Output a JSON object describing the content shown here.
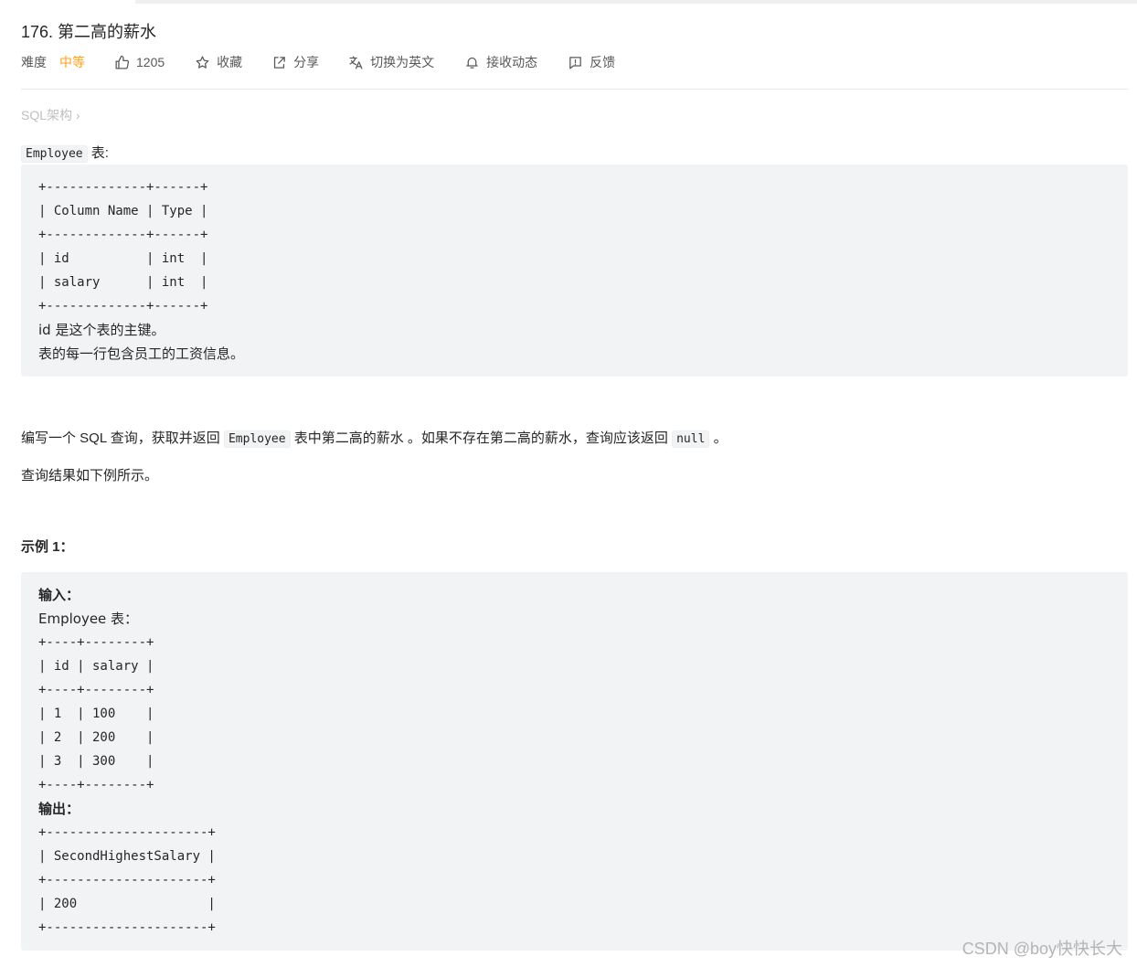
{
  "problem": {
    "title": "176. 第二高的薪水",
    "difficulty_label": "难度",
    "difficulty_value": "中等",
    "likes": "1205",
    "favorite_label": "收藏",
    "share_label": "分享",
    "translate_label": "切换为英文",
    "notify_label": "接收动态",
    "feedback_label": "反馈",
    "schema_link": "SQL架构",
    "schema_chevron": "›"
  },
  "colors": {
    "difficulty_medium": "#ffa116",
    "code_background": "#f2f3f5"
  },
  "icons": {
    "like": "thumbs-up-icon",
    "favorite": "star-icon",
    "share": "share-icon",
    "translate": "translate-icon",
    "notify": "bell-icon",
    "feedback": "feedback-icon"
  },
  "description": {
    "table_code": "Employee",
    "table_suffix": " 表:",
    "schema_block": [
      "+-------------+------+",
      "| Column Name | Type |",
      "+-------------+------+",
      "| id          | int  |",
      "| salary      | int  |",
      "+-------------+------+",
      "id 是这个表的主键。",
      "表的每一行包含员工的工资信息。"
    ],
    "task_part1": "编写一个 SQL 查询，获取并返回 ",
    "task_code1": "Employee",
    "task_part2": " 表中第二高的薪水 。如果不存在第二高的薪水，查询应该返回 ",
    "task_code2": "null",
    "task_part3": " 。",
    "result_note": "查询结果如下例所示。"
  },
  "example": {
    "title": "示例 1：",
    "input_label": "输入：",
    "input_table_name": "Employee 表：",
    "input_table": [
      "+----+--------+",
      "| id | salary |",
      "+----+--------+",
      "| 1  | 100    |",
      "| 2  | 200    |",
      "| 3  | 300    |",
      "+----+--------+"
    ],
    "output_label": "输出：",
    "output_table": [
      "+---------------------+",
      "| SecondHighestSalary |",
      "+---------------------+",
      "| 200                 |",
      "+---------------------+"
    ]
  },
  "watermark": "CSDN @boy快快长大"
}
